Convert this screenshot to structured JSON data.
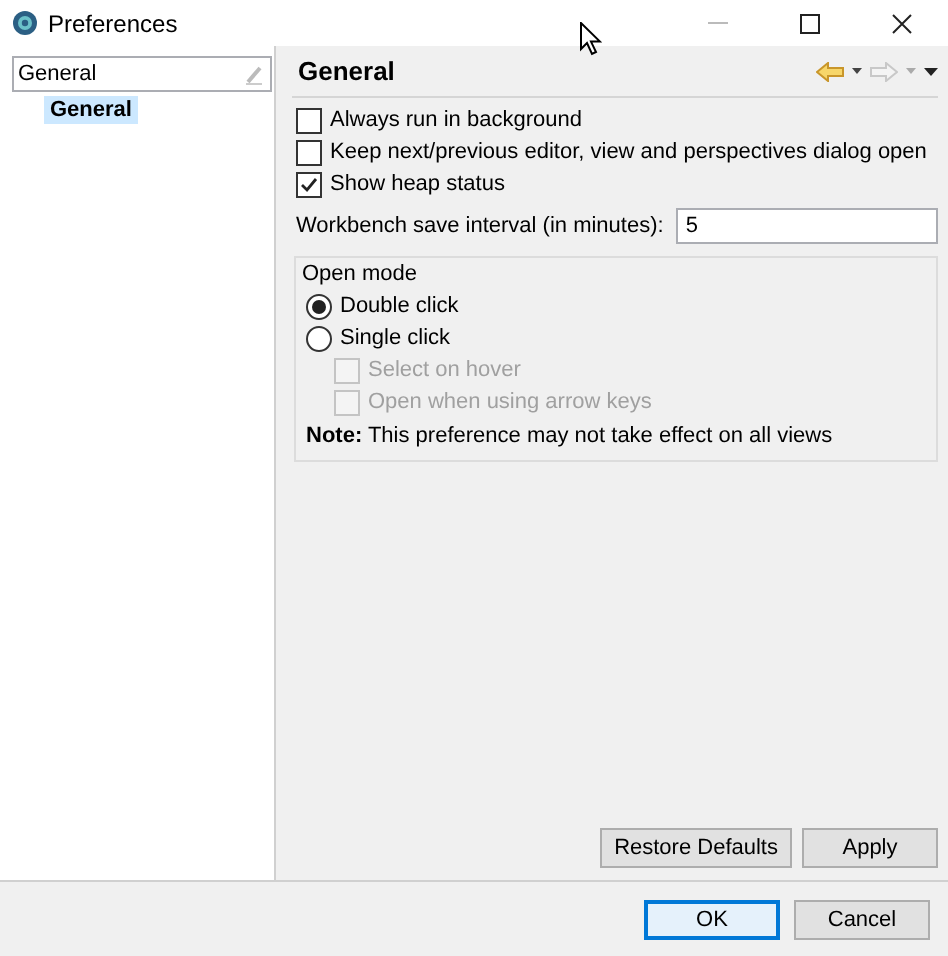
{
  "window": {
    "title": "Preferences"
  },
  "sidebar": {
    "filter": {
      "value": "General"
    },
    "items": [
      {
        "label": "General",
        "selected": true
      }
    ]
  },
  "page": {
    "title": "General",
    "navigation": {
      "back_enabled": true,
      "forward_enabled": false
    },
    "options": [
      {
        "label": "Always run in background",
        "checked": false
      },
      {
        "label": "Keep next/previous editor, view and perspectives dialog open",
        "checked": false
      },
      {
        "label": "Show heap status",
        "checked": true
      }
    ],
    "save_interval": {
      "label": "Workbench save interval (in minutes):",
      "value": "5"
    },
    "open_mode": {
      "title": "Open mode",
      "options": [
        {
          "kind": "radio",
          "label": "Double click",
          "selected": true,
          "disabled": false
        },
        {
          "kind": "radio",
          "label": "Single click",
          "selected": false,
          "disabled": false
        },
        {
          "kind": "checkbox",
          "label": "Select on hover",
          "checked": false,
          "disabled": true
        },
        {
          "kind": "checkbox",
          "label": "Open when using arrow keys",
          "checked": false,
          "disabled": true
        }
      ],
      "note": "**Note:** This preference may not take effect on all views"
    },
    "buttons": [
      "Restore Defaults",
      "Apply"
    ]
  },
  "dialog_buttons": [
    {
      "label": "OK",
      "default": true
    },
    {
      "label": "Cancel",
      "default": false
    }
  ]
}
